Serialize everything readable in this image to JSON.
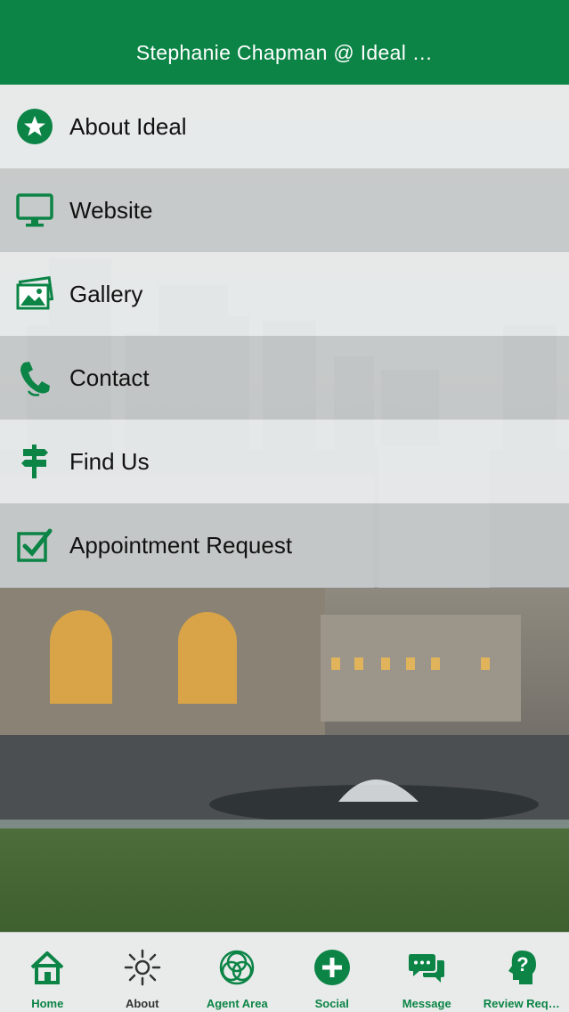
{
  "header": {
    "title": "Stephanie Chapman @ Ideal …"
  },
  "menu": {
    "items": [
      {
        "label": "About Ideal",
        "icon": "star-circle-icon"
      },
      {
        "label": "Website",
        "icon": "monitor-icon"
      },
      {
        "label": "Gallery",
        "icon": "pictures-icon"
      },
      {
        "label": "Contact",
        "icon": "phone-icon"
      },
      {
        "label": "Find Us",
        "icon": "signpost-icon"
      },
      {
        "label": "Appointment Request",
        "icon": "checkbox-icon"
      }
    ]
  },
  "tabbar": {
    "tabs": [
      {
        "label": "Home",
        "icon": "home-icon"
      },
      {
        "label": "About",
        "icon": "sun-icon"
      },
      {
        "label": "Agent Area",
        "icon": "rings-icon"
      },
      {
        "label": "Social",
        "icon": "plus-circle-icon"
      },
      {
        "label": "Message",
        "icon": "chat-bubbles-icon"
      },
      {
        "label": "Review Req…",
        "icon": "question-head-icon"
      }
    ]
  },
  "colors": {
    "brand": "#0b8446",
    "icon": "#0b8446"
  }
}
